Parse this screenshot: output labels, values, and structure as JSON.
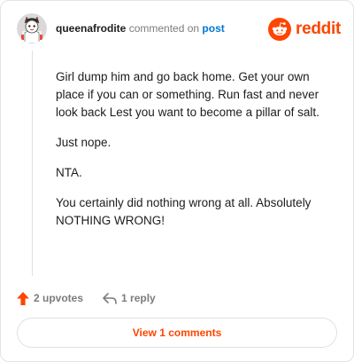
{
  "comment": {
    "username": "queenafrodite",
    "action_text": "commented on",
    "target_link": "post",
    "paragraphs": [
      "Girl dump him and go back home. Get your own place if you can or something. Run fast and never look back Lest you want to become a pillar of salt.",
      "Just nope.",
      "NTA.",
      "You certainly did nothing wrong at all. Absolutely NOTHING WRONG!"
    ]
  },
  "brand": {
    "wordmark": "reddit",
    "color": "#ff4500"
  },
  "actions": {
    "upvotes_label": "2 upvotes",
    "reply_label": "1 reply"
  },
  "view_comments_label": "View 1 comments",
  "icons": {
    "avatar": "avatar-icon",
    "logo": "reddit-logo-icon",
    "upvote": "upvote-arrow-icon",
    "reply": "reply-arrow-icon"
  }
}
